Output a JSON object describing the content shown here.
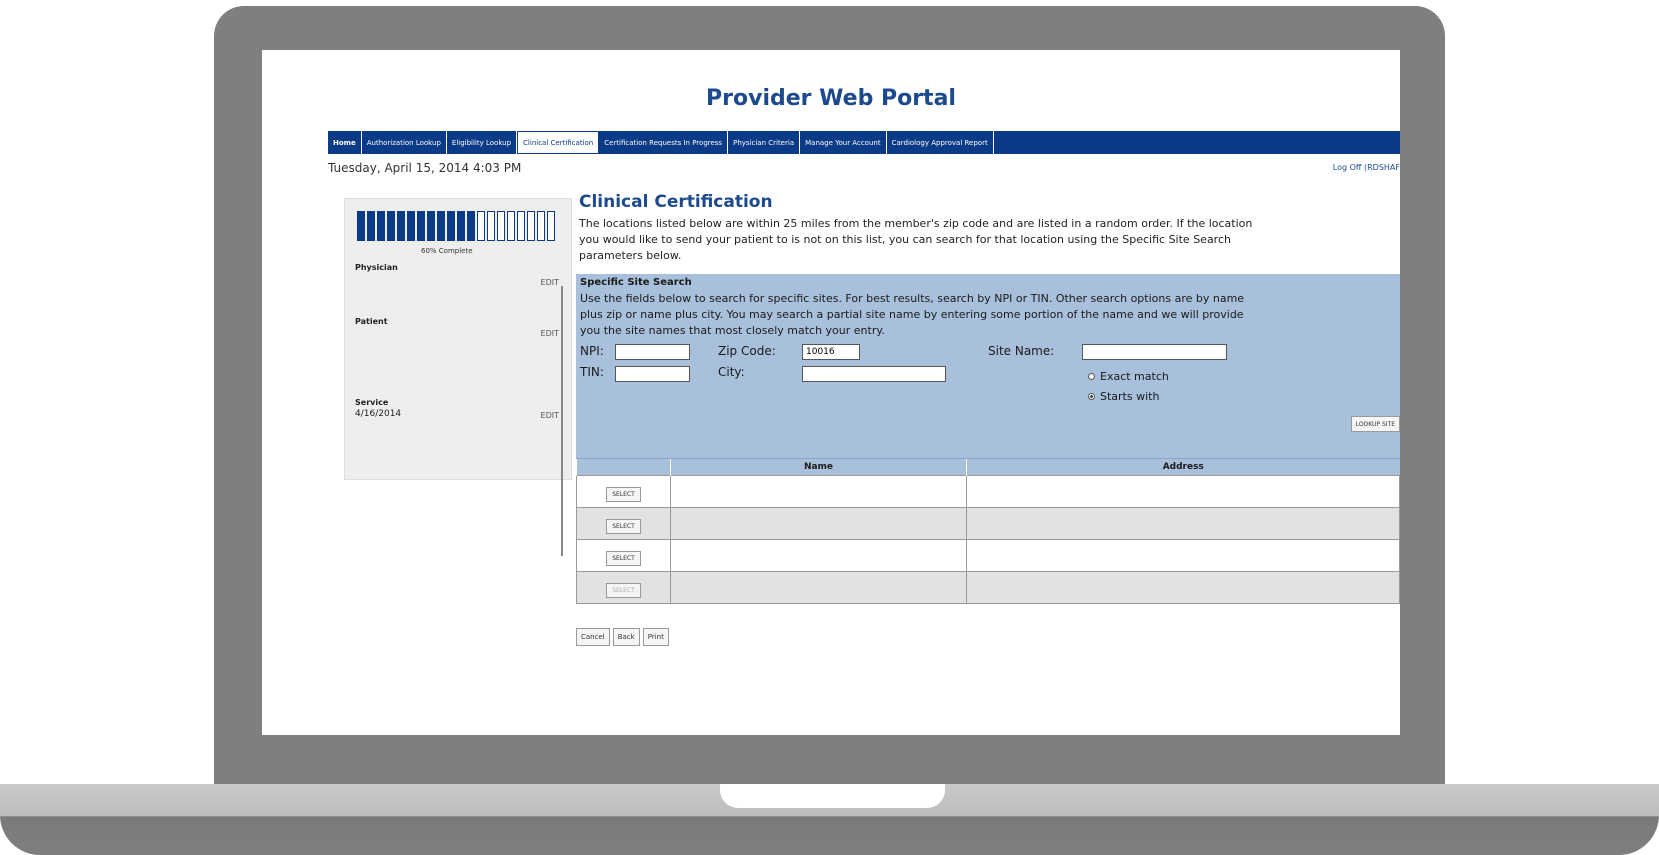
{
  "portal": {
    "title": "Provider Web Portal"
  },
  "nav": {
    "items": [
      {
        "label": "Home"
      },
      {
        "label": "Authorization Lookup"
      },
      {
        "label": "Eligibility Lookup"
      },
      {
        "label": "Clinical Certification"
      },
      {
        "label": "Certification Requests In Progress"
      },
      {
        "label": "Physician Criteria"
      },
      {
        "label": "Manage Your Account"
      },
      {
        "label": "Cardiology Approval Report"
      }
    ],
    "active": "Clinical Certification"
  },
  "header": {
    "datetime": "Tuesday, April 15, 2014 4:03 PM",
    "logoff": "Log Off (RDSHAF"
  },
  "progress": {
    "percent": 0.6,
    "segments_filled": 12,
    "segments_total": 20,
    "label": "60% Complete"
  },
  "steps": [
    {
      "label": "Physician",
      "value": "",
      "edit": "EDIT"
    },
    {
      "label": "Patient",
      "value": "",
      "edit": "EDIT"
    },
    {
      "label": "Service",
      "value": "4/16/2014",
      "edit": "EDIT"
    }
  ],
  "main": {
    "heading": "Clinical Certification",
    "intro": "The locations listed below are within 25 miles from the member's zip code and are listed in a random order. If the location you would like to send your patient to is not on this list, you can search for that location using the Specific Site Search parameters below."
  },
  "site_search": {
    "title": "Specific Site Search",
    "description": "Use the fields below to search for specific sites. For best results, search by NPI or TIN. Other search options are by name plus zip or name plus city. You may search a partial site name by entering some portion of the name and we will provide you the site names that most closely match your entry.",
    "npi_label": "NPI:",
    "npi_value": "",
    "tin_label": "TIN:",
    "tin_value": "",
    "zip_label": "Zip Code:",
    "zip_value": "10016",
    "city_label": "City:",
    "city_value": "",
    "site_name_label": "Site Name:",
    "site_name_value": "",
    "match_options": [
      {
        "label": "Exact match",
        "checked": false
      },
      {
        "label": "Starts with",
        "checked": true
      }
    ],
    "lookup_label": "LOOKUP SITE"
  },
  "results": {
    "columns": [
      "",
      "Name",
      "Address"
    ],
    "rows": [
      {
        "select": "SELECT",
        "name": "",
        "address": ""
      },
      {
        "select": "SELECT",
        "name": "",
        "address": ""
      },
      {
        "select": "SELECT",
        "name": "",
        "address": ""
      },
      {
        "select": "SELECT",
        "name": "",
        "address": ""
      }
    ]
  },
  "actions": {
    "cancel": "Cancel",
    "back": "Back",
    "print": "Print"
  },
  "colors": {
    "brand": "#0b3a87",
    "title": "#1c4a8c",
    "panel": "#a9c0dc",
    "frame": "#7f7f7f"
  }
}
